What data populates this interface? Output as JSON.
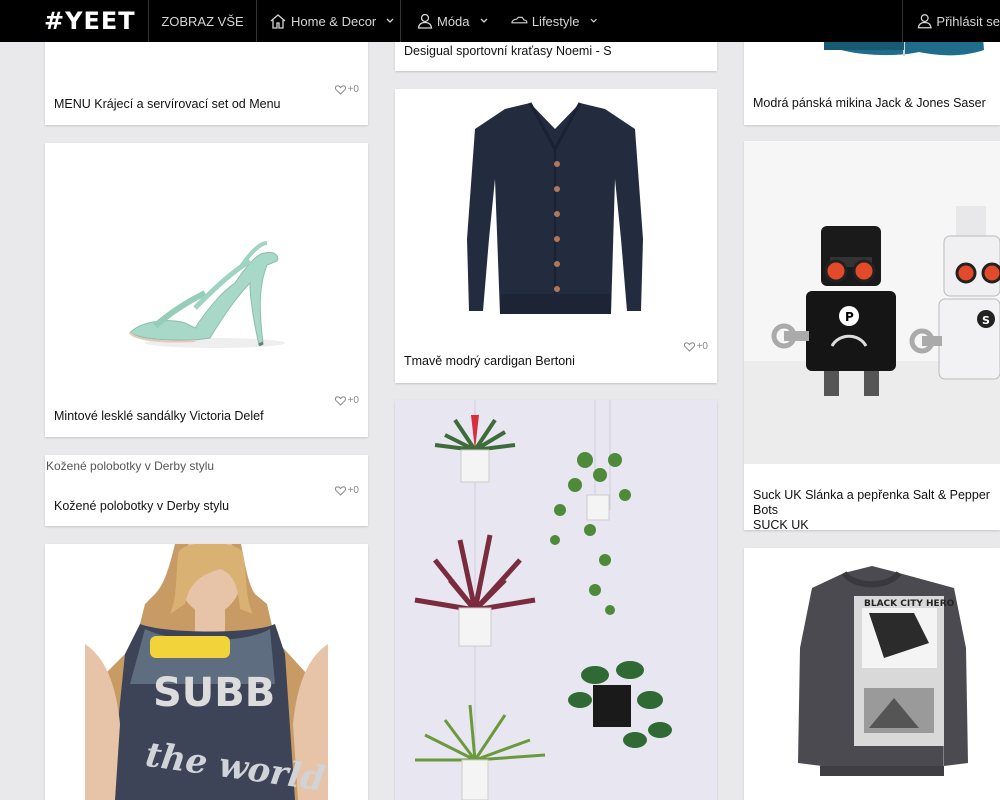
{
  "nav": {
    "logo": "#YEET",
    "all": "ZOBRAZ VŠE",
    "home": "Home & Decor",
    "moda": "Móda",
    "lifestyle": "Lifestyle",
    "login": "Přihlásit se"
  },
  "cards": {
    "menu_set": {
      "title": "MENU Krájecí a servírovací set od Menu",
      "likes": "+0"
    },
    "sandals": {
      "title": "Mintové lesklé sandálky Victoria Delef",
      "likes": "+0"
    },
    "derby": {
      "alt": "Kožené polobotky v Derby stylu",
      "title": "Kožené polobotky v Derby stylu",
      "likes": "+0"
    },
    "desigual": {
      "title": "Desigual sportovní kraťasy Noemi - S"
    },
    "cardigan": {
      "title": "Tmavě modrý cardigan Bertoni",
      "likes": "+0"
    },
    "mikina": {
      "title": "Modrá pánská mikina Jack & Jones Saser"
    },
    "robots": {
      "title": "Suck UK Slánka a pepřenka Salt & Pepper Bots",
      "title2": "SUCK UK"
    },
    "sweatshirt_text": "BLACK CITY HERO",
    "dress_text1": "SUBB",
    "dress_text2": "the world"
  },
  "colors": {
    "accent": "#000000",
    "background": "#e9e8eb"
  }
}
